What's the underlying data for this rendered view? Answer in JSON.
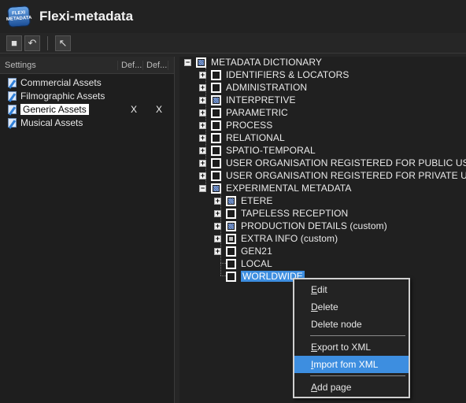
{
  "app": {
    "title": "Flexi-metadata",
    "logo_line1": "FLEXI",
    "logo_line2": "METADATA"
  },
  "toolbar": {
    "buttons": [
      {
        "name": "stop-icon",
        "glyph": "■"
      },
      {
        "name": "undo-icon",
        "glyph": "↶"
      },
      {
        "name": "pointer-icon",
        "glyph": "↖"
      }
    ]
  },
  "settings": {
    "columns": [
      "Settings",
      "Def...",
      "Def..."
    ],
    "rows": [
      {
        "label": "Commercial Assets",
        "def1": "",
        "def2": ""
      },
      {
        "label": "Filmographic Assets",
        "def1": "",
        "def2": ""
      },
      {
        "label": "Generic Assets",
        "def1": "X",
        "def2": "X",
        "selected": true
      },
      {
        "label": "Musical Assets",
        "def1": "",
        "def2": ""
      }
    ]
  },
  "tree": {
    "root": "METADATA DICTIONARY",
    "nodes": [
      {
        "label": "IDENTIFIERS & LOCATORS",
        "level": 1,
        "expander": "+",
        "check": "empty"
      },
      {
        "label": "ADMINISTRATION",
        "level": 1,
        "expander": "+",
        "check": "empty"
      },
      {
        "label": "INTERPRETIVE",
        "level": 1,
        "expander": "+",
        "check": "partial"
      },
      {
        "label": "PARAMETRIC",
        "level": 1,
        "expander": "+",
        "check": "empty"
      },
      {
        "label": "PROCESS",
        "level": 1,
        "expander": "+",
        "check": "empty"
      },
      {
        "label": "RELATIONAL",
        "level": 1,
        "expander": "+",
        "check": "empty"
      },
      {
        "label": "SPATIO-TEMPORAL",
        "level": 1,
        "expander": "+",
        "check": "empty"
      },
      {
        "label": "USER ORGANISATION REGISTERED FOR PUBLIC USE",
        "level": 1,
        "expander": "+",
        "check": "empty"
      },
      {
        "label": "USER ORGANISATION REGISTERED FOR PRIVATE USE",
        "level": 1,
        "expander": "+",
        "check": "empty"
      },
      {
        "label": "EXPERIMENTAL METADATA",
        "level": 1,
        "expander": "−",
        "check": "partial"
      },
      {
        "label": "ETERE",
        "level": 2,
        "expander": "+",
        "check": "partial"
      },
      {
        "label": "TAPELESS RECEPTION",
        "level": 2,
        "expander": "+",
        "check": "empty"
      },
      {
        "label": "PRODUCTION DETAILS (custom)",
        "level": 2,
        "expander": "+",
        "check": "partial"
      },
      {
        "label": "EXTRA INFO (custom)",
        "level": 2,
        "expander": "+",
        "check": "white-fill"
      },
      {
        "label": "GEN21",
        "level": 2,
        "expander": "+",
        "check": "empty"
      },
      {
        "label": "LOCAL",
        "level": 2,
        "expander": "",
        "check": "empty"
      },
      {
        "label": "WORLDWIDE",
        "level": 2,
        "expander": "",
        "check": "empty",
        "highlight": true
      }
    ]
  },
  "context_menu": {
    "items": [
      {
        "label": "Edit",
        "accel": "E",
        "rest": "dit"
      },
      {
        "label": "Delete",
        "accel": "D",
        "rest": "elete"
      },
      {
        "label": "Delete node",
        "accel": "",
        "rest": "Delete node"
      },
      {
        "label": "Export to XML",
        "accel": "E",
        "rest": "xport to XML"
      },
      {
        "label": "Import fom XML",
        "accel": "I",
        "rest": "mport fom XML",
        "active": true
      },
      {
        "label": "Add page",
        "accel": "A",
        "rest": "dd page"
      }
    ]
  }
}
